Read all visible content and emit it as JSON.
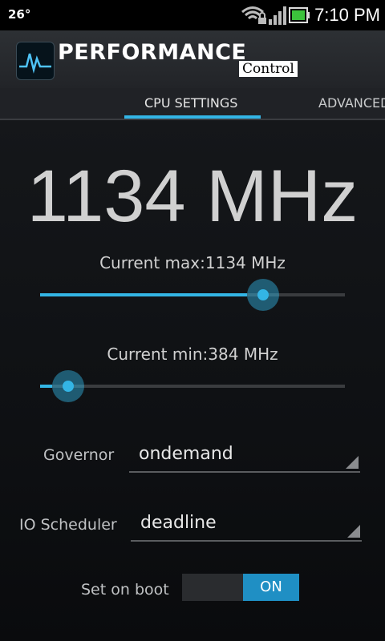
{
  "status_bar": {
    "temperature": "26°",
    "time": "7:10 PM",
    "icons": [
      "wifi-lock-icon",
      "signal-icon",
      "battery-icon"
    ]
  },
  "app": {
    "title": "PERFORMANCE",
    "subtitle": "Control"
  },
  "tabs": {
    "active": "CPU SETTINGS",
    "next": "ADVANCED"
  },
  "cpu": {
    "current_frequency": "1134 MHz",
    "max_label": "Current max:1134 MHz",
    "max_slider_fraction": 0.68,
    "min_label": "Current min:384 MHz",
    "min_slider_fraction": 0.04
  },
  "governor": {
    "label": "Governor",
    "value": "ondemand"
  },
  "io_scheduler": {
    "label": "IO Scheduler",
    "value": "deadline"
  },
  "set_on_boot": {
    "label": "Set on boot",
    "state": "ON"
  },
  "colors": {
    "accent": "#33b5e5",
    "toggle_on": "#1f8fc4"
  }
}
